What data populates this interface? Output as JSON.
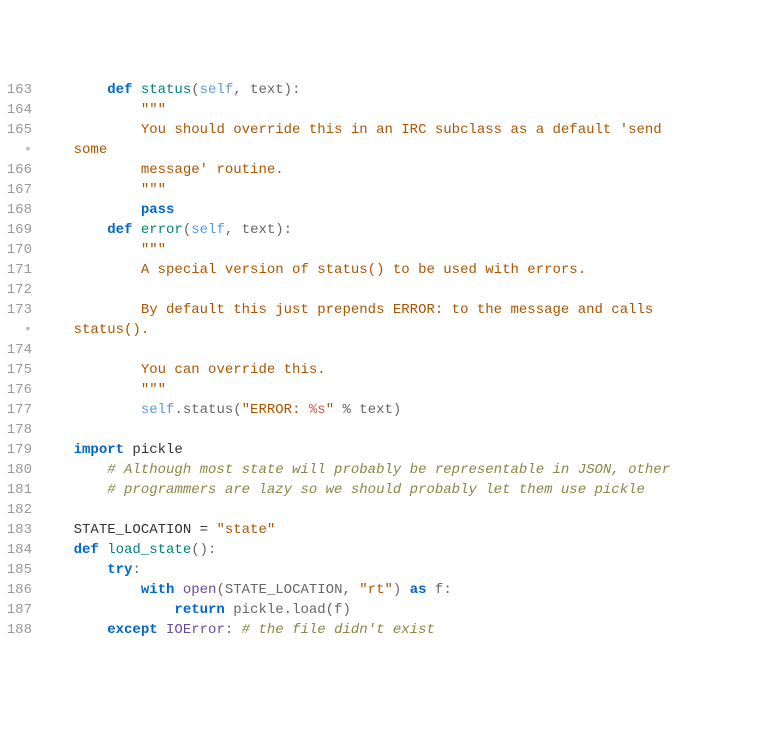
{
  "lines": [
    {
      "num": "163",
      "indent": "        ",
      "tokens": [
        {
          "t": "def ",
          "c": "kw"
        },
        {
          "t": "status",
          "c": "fn"
        },
        {
          "t": "(",
          "c": "op"
        },
        {
          "t": "self",
          "c": "param"
        },
        {
          "t": ", text):",
          "c": "op"
        }
      ]
    },
    {
      "num": "164",
      "indent": "            ",
      "tokens": [
        {
          "t": "\"\"\"",
          "c": "str"
        }
      ]
    },
    {
      "num": "165",
      "indent": "            ",
      "tokens": [
        {
          "t": "You should override this in an IRC subclass as a default 'send ",
          "c": "str"
        }
      ]
    },
    {
      "num": "•",
      "dot": true,
      "indent": "    ",
      "tokens": [
        {
          "t": "some",
          "c": "str"
        }
      ]
    },
    {
      "num": "166",
      "indent": "            ",
      "tokens": [
        {
          "t": "message' routine.",
          "c": "str"
        }
      ]
    },
    {
      "num": "167",
      "indent": "            ",
      "tokens": [
        {
          "t": "\"\"\"",
          "c": "str"
        }
      ]
    },
    {
      "num": "168",
      "indent": "            ",
      "tokens": [
        {
          "t": "pass",
          "c": "kw"
        }
      ]
    },
    {
      "num": "169",
      "indent": "        ",
      "tokens": [
        {
          "t": "def ",
          "c": "kw"
        },
        {
          "t": "error",
          "c": "fn"
        },
        {
          "t": "(",
          "c": "op"
        },
        {
          "t": "self",
          "c": "param"
        },
        {
          "t": ", text):",
          "c": "op"
        }
      ]
    },
    {
      "num": "170",
      "indent": "            ",
      "tokens": [
        {
          "t": "\"\"\"",
          "c": "str"
        }
      ]
    },
    {
      "num": "171",
      "indent": "            ",
      "tokens": [
        {
          "t": "A special version of status() to be used with errors.",
          "c": "str"
        }
      ]
    },
    {
      "num": "172",
      "indent": "",
      "tokens": []
    },
    {
      "num": "173",
      "indent": "            ",
      "tokens": [
        {
          "t": "By default this just prepends ERROR: to the message and calls ",
          "c": "str"
        }
      ]
    },
    {
      "num": "•",
      "dot": true,
      "indent": "    ",
      "tokens": [
        {
          "t": "status().",
          "c": "str"
        }
      ]
    },
    {
      "num": "174",
      "indent": "",
      "tokens": []
    },
    {
      "num": "175",
      "indent": "            ",
      "tokens": [
        {
          "t": "You can override this.",
          "c": "str"
        }
      ]
    },
    {
      "num": "176",
      "indent": "            ",
      "tokens": [
        {
          "t": "\"\"\"",
          "c": "str"
        }
      ]
    },
    {
      "num": "177",
      "indent": "            ",
      "tokens": [
        {
          "t": "self",
          "c": "param"
        },
        {
          "t": ".status(",
          "c": "op"
        },
        {
          "t": "\"ERROR: ",
          "c": "str"
        },
        {
          "t": "%s",
          "c": "fmt"
        },
        {
          "t": "\"",
          "c": "str"
        },
        {
          "t": " % text)",
          "c": "op"
        }
      ]
    },
    {
      "num": "178",
      "indent": "",
      "tokens": []
    },
    {
      "num": "179",
      "indent": "    ",
      "tokens": [
        {
          "t": "import ",
          "c": "kw"
        },
        {
          "t": "pickle",
          "c": "name"
        }
      ]
    },
    {
      "num": "180",
      "indent": "        ",
      "tokens": [
        {
          "t": "# Although most state will probably be representable in JSON, other",
          "c": "cmt"
        }
      ]
    },
    {
      "num": "181",
      "indent": "        ",
      "tokens": [
        {
          "t": "# programmers are lazy so we should probably let them use pickle",
          "c": "cmt"
        }
      ]
    },
    {
      "num": "182",
      "indent": "",
      "tokens": []
    },
    {
      "num": "183",
      "indent": "    ",
      "tokens": [
        {
          "t": "STATE_LOCATION = ",
          "c": "const"
        },
        {
          "t": "\"state\"",
          "c": "str"
        }
      ]
    },
    {
      "num": "184",
      "indent": "    ",
      "tokens": [
        {
          "t": "def ",
          "c": "kw"
        },
        {
          "t": "load_state",
          "c": "fn"
        },
        {
          "t": "():",
          "c": "op"
        }
      ]
    },
    {
      "num": "185",
      "indent": "        ",
      "tokens": [
        {
          "t": "try",
          "c": "kw"
        },
        {
          "t": ":",
          "c": "op"
        }
      ]
    },
    {
      "num": "186",
      "indent": "            ",
      "tokens": [
        {
          "t": "with ",
          "c": "kw"
        },
        {
          "t": "open",
          "c": "bif"
        },
        {
          "t": "(STATE_LOCATION, ",
          "c": "op"
        },
        {
          "t": "\"rt\"",
          "c": "str"
        },
        {
          "t": ") ",
          "c": "op"
        },
        {
          "t": "as",
          "c": "kw"
        },
        {
          "t": " f:",
          "c": "op"
        }
      ]
    },
    {
      "num": "187",
      "indent": "                ",
      "tokens": [
        {
          "t": "return ",
          "c": "kw"
        },
        {
          "t": "pickle.load(f)",
          "c": "op"
        }
      ]
    },
    {
      "num": "188",
      "indent": "        ",
      "tokens": [
        {
          "t": "except ",
          "c": "kw"
        },
        {
          "t": "IOError",
          "c": "bif"
        },
        {
          "t": ": ",
          "c": "op"
        },
        {
          "t": "# the file didn't exist",
          "c": "cmt"
        }
      ]
    }
  ]
}
